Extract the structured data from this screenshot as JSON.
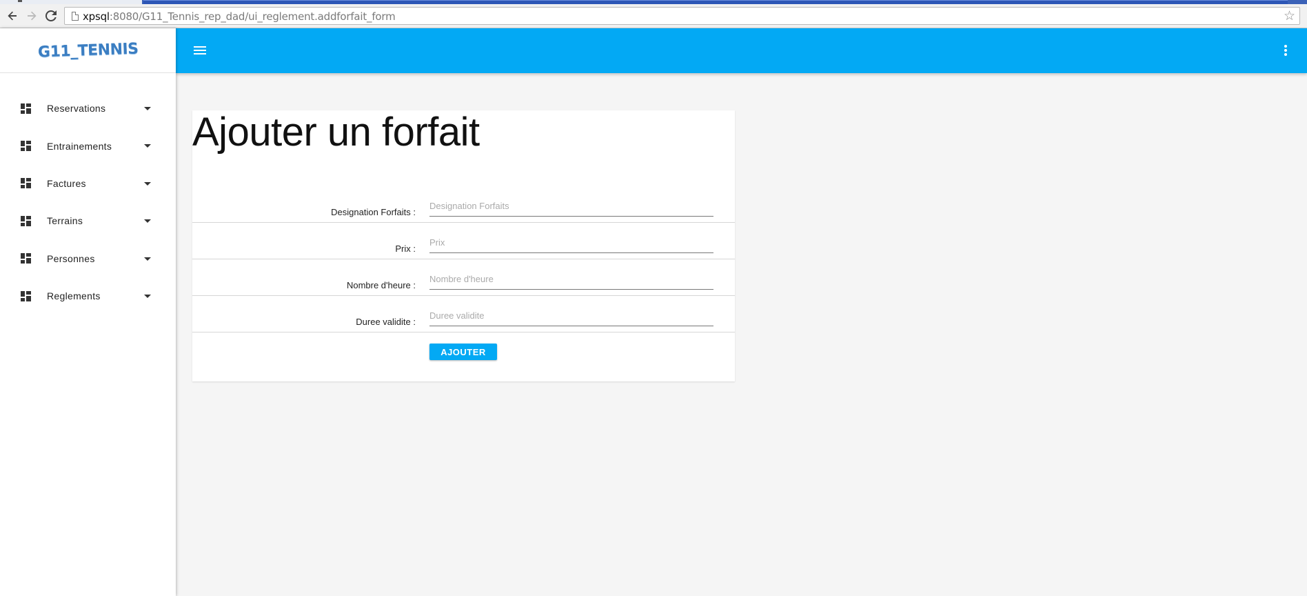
{
  "browser": {
    "url_host": "xpsql",
    "url_rest": ":8080/G11_Tennis_rep_dad/ui_reglement.addforfait_form",
    "back_icon": "arrow-left-icon",
    "forward_icon": "arrow-right-icon",
    "reload_icon": "reload-icon",
    "bookmark_icon": "star-icon"
  },
  "sidebar": {
    "brand": "G11_TENNIS",
    "items": [
      {
        "label": "Reservations",
        "icon": "dashboard-icon"
      },
      {
        "label": "Entrainements",
        "icon": "dashboard-icon"
      },
      {
        "label": "Factures",
        "icon": "dashboard-icon"
      },
      {
        "label": "Terrains",
        "icon": "dashboard-icon"
      },
      {
        "label": "Personnes",
        "icon": "dashboard-icon"
      },
      {
        "label": "Reglements",
        "icon": "dashboard-icon"
      }
    ]
  },
  "appbar": {
    "menu_icon": "hamburger-menu-icon",
    "more_icon": "more-vert-icon",
    "color": "#03a9f4"
  },
  "form": {
    "title": "Ajouter un forfait",
    "fields": [
      {
        "label": "Designation Forfaits :",
        "placeholder": "Designation Forfaits",
        "value": ""
      },
      {
        "label": "Prix :",
        "placeholder": "Prix",
        "value": ""
      },
      {
        "label": "Nombre d'heure :",
        "placeholder": "Nombre d'heure",
        "value": ""
      },
      {
        "label": "Duree validite :",
        "placeholder": "Duree validite",
        "value": ""
      }
    ],
    "submit_label": "AJOUTER"
  }
}
